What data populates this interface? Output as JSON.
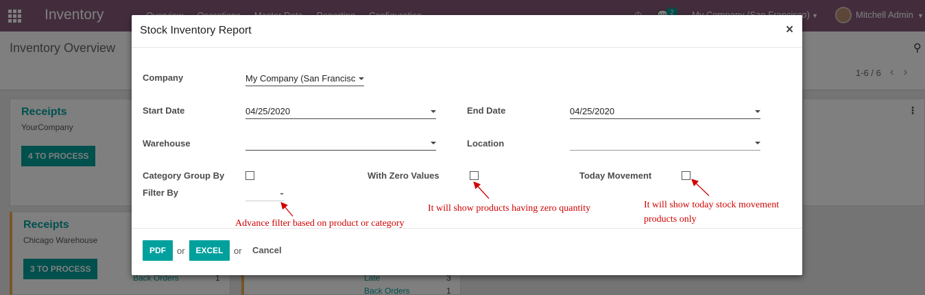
{
  "navbar": {
    "brand": "Inventory",
    "menu": [
      "Overview",
      "Operations",
      "Master Data",
      "Reporting",
      "Configuration"
    ],
    "chat_badge": "2",
    "company": "My Company (San Francisco)",
    "user": "Mitchell Admin"
  },
  "control_panel": {
    "title": "Inventory Overview",
    "pager": "1-6 / 6"
  },
  "cards": [
    {
      "title": "Receipts",
      "subtitle": "YourCompany",
      "button": "4 TO PROCESS"
    },
    {
      "title": "Receipts",
      "subtitle": "Chicago Warehouse",
      "button": "3 TO PROCESS",
      "link": "Back Orders",
      "count": "1"
    }
  ],
  "bg_stats": [
    {
      "label": "Late",
      "count": "3"
    },
    {
      "label": "Back Orders",
      "count": "1"
    }
  ],
  "dialog": {
    "title": "Stock Inventory Report",
    "close": "×",
    "company_label": "Company",
    "company_value": "My Company (San Francisc",
    "start_date_label": "Start Date",
    "start_date_value": "04/25/2020",
    "end_date_label": "End Date",
    "end_date_value": "04/25/2020",
    "warehouse_label": "Warehouse",
    "warehouse_value": "",
    "location_label": "Location",
    "location_value": "",
    "category_group_label": "Category Group By",
    "zero_values_label": "With Zero Values",
    "today_movement_label": "Today Movement",
    "filter_by_label": "Filter By",
    "filter_by_value": "",
    "pdf_button": "PDF",
    "or_1": "or",
    "excel_button": "EXCEL",
    "or_2": "or",
    "cancel_button": "Cancel"
  },
  "annotations": {
    "filter_note": "Advance filter based on product or category",
    "zero_note": "It will show products having zero quantity",
    "today_note_line1": "It will show today stock movement",
    "today_note_line2": "products only",
    "color": "#d00000"
  },
  "colors": {
    "navbar": "#875a7b",
    "primary": "#00a09d"
  }
}
